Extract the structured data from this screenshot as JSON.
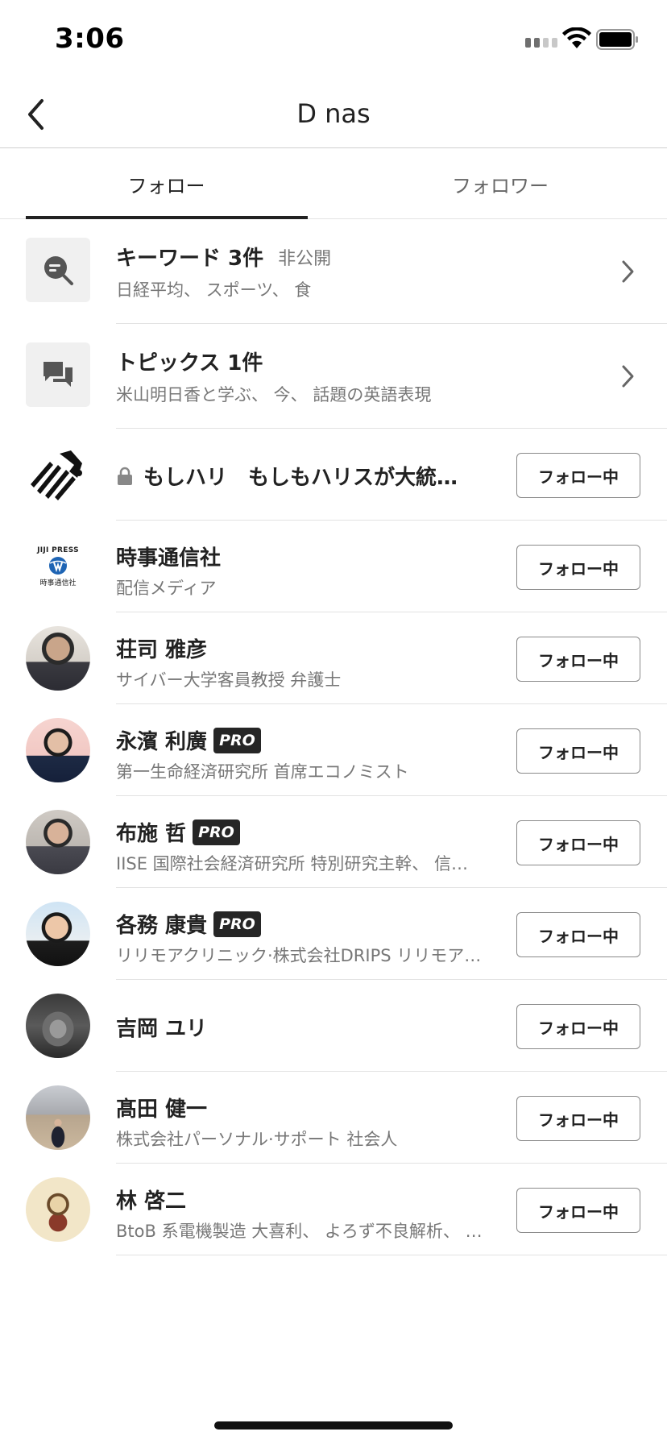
{
  "status_bar": {
    "time": "3:06"
  },
  "nav": {
    "title": "D nas"
  },
  "tabs": {
    "follow": "フォロー",
    "follower": "フォロワー"
  },
  "summary_rows": [
    {
      "title": "キーワード 3件",
      "badge": "非公開",
      "subtitle": "日経平均、 スポーツ、 食",
      "icon": "keyword-search-icon"
    },
    {
      "title": "トピックス 1件",
      "subtitle": "米山明日香と学ぶ、 今、 話題の英語表現",
      "icon": "chat-bubbles-icon"
    }
  ],
  "follow_button_label": "フォロー中",
  "pro_label": "PRO",
  "people": [
    {
      "name": "もしハリ　もしもハリスが大統領に…",
      "subtitle": "",
      "locked": true,
      "pro": false,
      "avatar": "zebra-logo"
    },
    {
      "name": "時事通信社",
      "subtitle": "配信メディア",
      "locked": false,
      "pro": false,
      "avatar": "jiji-press-logo",
      "logo_text_top": "JIJI PRESS",
      "logo_text_bottom": "時事通信社"
    },
    {
      "name": "荘司 雅彦",
      "subtitle": "サイバー大学客員教授 弁護士",
      "locked": false,
      "pro": false,
      "avatar": "person-photo"
    },
    {
      "name": "永濱 利廣",
      "subtitle": "第一生命経済研究所 首席エコノミスト",
      "locked": false,
      "pro": true,
      "avatar": "person-photo"
    },
    {
      "name": "布施 哲",
      "subtitle": "IISE 国際社会経済研究所 特別研究主幹、 信…",
      "locked": false,
      "pro": true,
      "avatar": "person-photo"
    },
    {
      "name": "各務 康貴",
      "subtitle": "リリモアクリニック·株式会社DRIPS リリモア…",
      "locked": false,
      "pro": true,
      "avatar": "person-photo"
    },
    {
      "name": "吉岡 ユリ",
      "subtitle": "",
      "locked": false,
      "pro": false,
      "avatar": "person-photo"
    },
    {
      "name": "髙田 健一",
      "subtitle": "株式会社パーソナル·サポート 社会人",
      "locked": false,
      "pro": false,
      "avatar": "person-photo"
    },
    {
      "name": "林 啓二",
      "subtitle": "BtoB 系電機製造 大喜利、 よろず不良解析、 …",
      "locked": false,
      "pro": false,
      "avatar": "illustration"
    }
  ]
}
